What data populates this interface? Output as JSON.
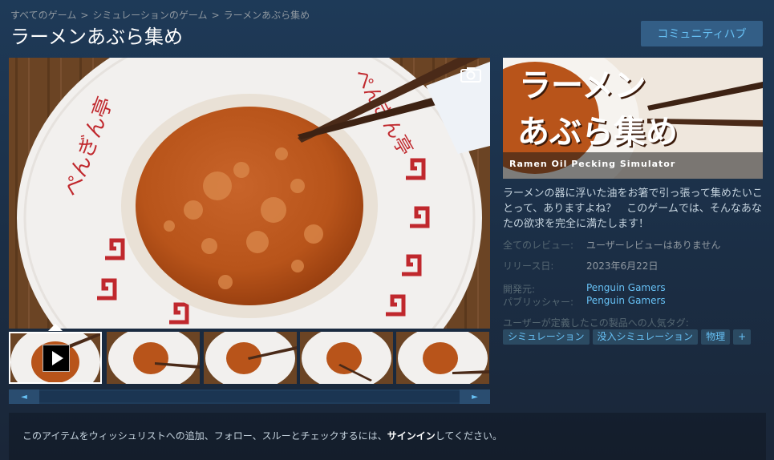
{
  "breadcrumb": [
    "すべてのゲーム",
    "シミュレーションのゲーム",
    "ラーメンあぶら集め"
  ],
  "breadcrumb_sep": ">",
  "game_title": "ラーメンあぶら集め",
  "community_hub_label": "コミュニティハブ",
  "capsule": {
    "logo_line1": "ラーメン",
    "logo_line2": "あぶら集め",
    "logo_subtitle": "Ramen Oil Pecking Simulator"
  },
  "bowl_text": "ぺんぎん亭",
  "description": "ラーメンの器に浮いた油をお箸で引っ張って集めたいことって、ありますよね？　このゲームでは、そんなあなたの欲求を完全に満たします！",
  "reviews": {
    "label": "全てのレビュー:",
    "value": "ユーザーレビューはありません"
  },
  "release": {
    "label": "リリース日:",
    "value": "2023年6月22日"
  },
  "developer": {
    "label": "開発元:",
    "value": "Penguin Gamers"
  },
  "publisher": {
    "label": "パブリッシャー:",
    "value": "Penguin Gamers"
  },
  "tags_label": "ユーザーが定義したこの製品への人気タグ:",
  "tags": [
    "シミュレーション",
    "没入シミュレーション",
    "物理",
    "+"
  ],
  "signin": {
    "before": "このアイテムをウィッシュリストへの追加、フォロー、スルーとチェックするには、",
    "link": "サインイン",
    "after": "してください。"
  },
  "icons": {
    "screenshot": "camera-icon",
    "play": "play-icon",
    "scroll_left": "arrow-left-icon",
    "scroll_right": "arrow-right-icon"
  },
  "scroll_left_glyph": "◄",
  "scroll_right_glyph": "►",
  "colors": {
    "accent": "#67c1f5",
    "button_bg": "#335e86",
    "broth": "#b8541a",
    "bowl_red": "#c0282d"
  }
}
